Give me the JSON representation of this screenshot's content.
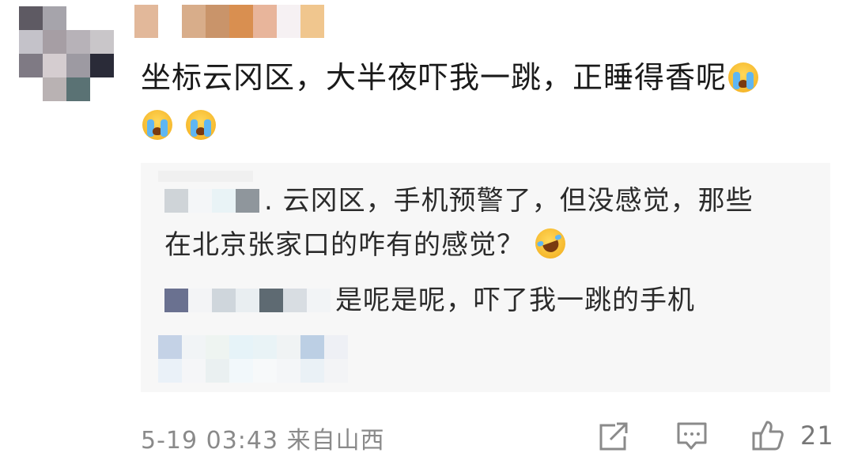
{
  "comment": {
    "text": "坐标云冈区，大半夜吓我一跳，正睡得香呢",
    "emoji_after_text": "crying-face-emoji",
    "emojis_second_line": [
      "crying-face-emoji",
      "crying-face-emoji"
    ]
  },
  "replies": [
    {
      "text": ". 云冈区，手机预警了，但没感觉，那些",
      "text2": "在北京张家口的咋有的感觉？",
      "emoji": "laughing-crying-emoji"
    },
    {
      "text": "是呢是呢，吓了我一跳的手机"
    }
  ],
  "footer": {
    "timestamp": "5-19 03:43",
    "location": "来自山西",
    "like_count": "21",
    "icons": [
      "share-icon",
      "comment-icon",
      "like-icon"
    ]
  },
  "colors": {
    "reply_background": "#f7f7f7",
    "meta_text": "#8a8a8a"
  }
}
